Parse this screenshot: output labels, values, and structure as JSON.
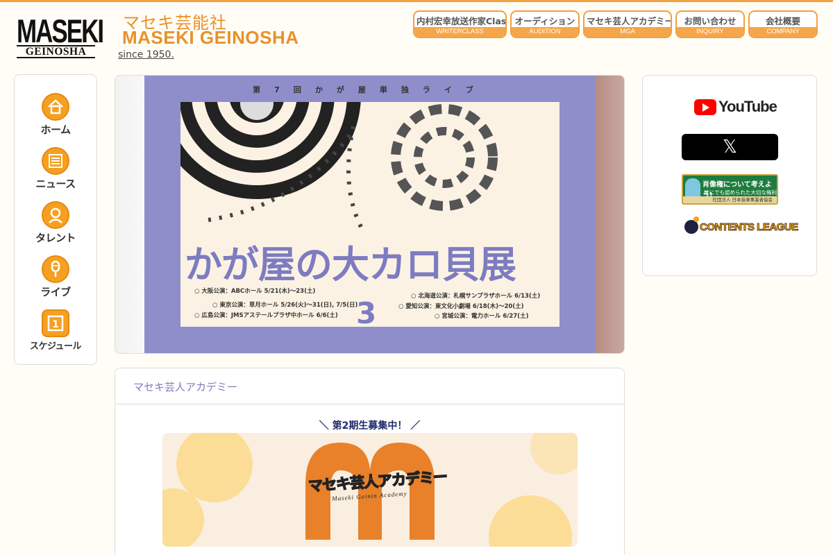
{
  "header": {
    "logo_line1": "MASEKI",
    "logo_line2": "GEINOSHA",
    "brand_jp": "マセキ芸能社",
    "brand_en": "MASEKI GEINOSHA",
    "since": "since 1950."
  },
  "nav": [
    {
      "jp": "内村宏幸放送作家Class",
      "en": "WRITERCLASS"
    },
    {
      "jp": "オーディション",
      "en": "AUDITION"
    },
    {
      "jp": "マセキ芸人アカデミー",
      "en": "MGA"
    },
    {
      "jp": "お問い合わせ",
      "en": "INQUIRY"
    },
    {
      "jp": "会社概要",
      "en": "COMPANY"
    }
  ],
  "sidebar": [
    {
      "label": "ホーム",
      "icon": "home-icon"
    },
    {
      "label": "ニュース",
      "icon": "news-icon"
    },
    {
      "label": "タレント",
      "icon": "talent-icon"
    },
    {
      "label": "ライブ",
      "icon": "live-icon"
    },
    {
      "label": "スケジュール",
      "icon": "schedule-icon"
    }
  ],
  "hero": {
    "top_text": "第7回かが屋単独ライブ",
    "title": "かが屋の大カロ貝展",
    "number": "3",
    "venues": [
      "○ 大阪公演：ABCホール 5/21(木)～23(土)",
      "○ 東京公演：草月ホール 5/26(火)～31(日), 7/5(日)",
      "○ 広島公演：JMSアステールプラザ中ホール 6/6(土)",
      "○ 北海道公演：札幌サンプラザホール 6/13(土)",
      "○ 愛知公演：東文化小劇場 6/18(木)～20(土)",
      "○ 宮城公演：電力ホール 6/27(土)"
    ]
  },
  "right_panel": {
    "youtube_label": "YouTube",
    "x_label": "𝕏",
    "shozo_title": "肖像権について考えよう!",
    "shozo_sub": "誰にでも認められた大切な権利",
    "shozo_org": "社団法人 日本音楽事業者協会",
    "contents_league": "CONTENTS LEAGUE"
  },
  "academy": {
    "heading": "マセキ芸人アカデミー",
    "subtitle": "＼ 第2期生募集中！ ／",
    "logo_text": "マセキ芸人アカデミー",
    "logo_sub": "Maseki Geinin Academy"
  },
  "colors": {
    "accent": "#f0a040",
    "brand": "#e8912a",
    "hero_purple": "#8f8ecb",
    "heading_purple": "#7d7cc1"
  }
}
